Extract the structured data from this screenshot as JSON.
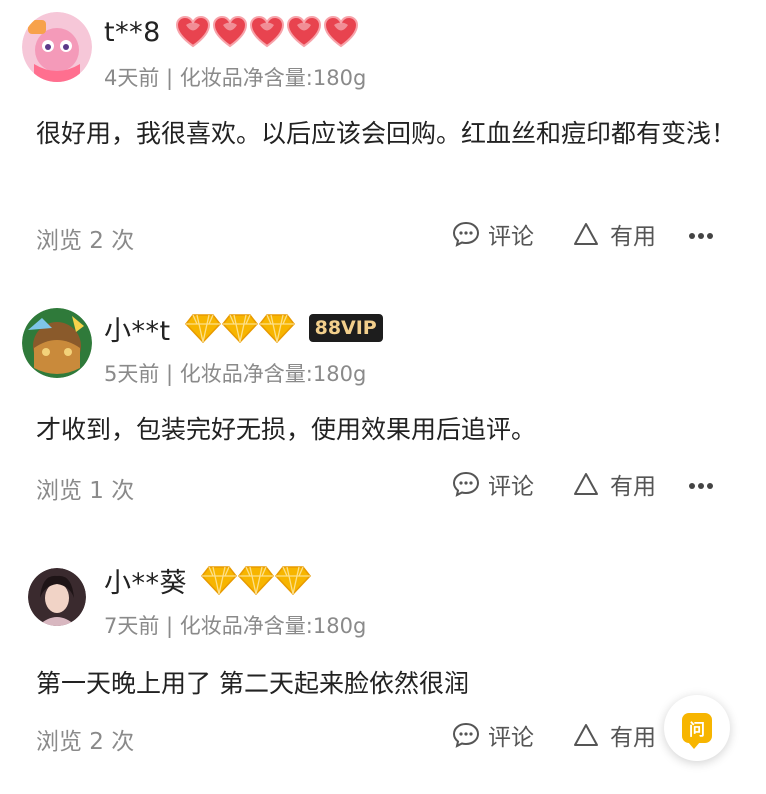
{
  "reviews": [
    {
      "username": "t**8",
      "level": "hearts",
      "level_count": 5,
      "vip": "",
      "meta": "4天前 | 化妆品净含量:180g",
      "content": "很好用，我很喜欢。以后应该会回购。红血丝和痘印都有变浅！",
      "views": "浏览 2 次",
      "comment_label": "评论",
      "useful_label": "有用"
    },
    {
      "username": "小**t",
      "level": "diamonds",
      "level_count": 3,
      "vip": "88VIP",
      "meta": "5天前 | 化妆品净含量:180g",
      "content": "才收到，包装完好无损，使用效果用后追评。",
      "views": "浏览 1 次",
      "comment_label": "评论",
      "useful_label": "有用"
    },
    {
      "username": "小**葵",
      "level": "diamonds",
      "level_count": 3,
      "vip": "",
      "meta": "7天前 | 化妆品净含量:180g",
      "content": "第一天晚上用了 第二天起来脸依然很润",
      "views": "浏览 2 次",
      "comment_label": "评论",
      "useful_label": "有用"
    }
  ],
  "fab": {
    "label": "问",
    "icon": "question-icon"
  },
  "colors": {
    "heart": "#e8434f",
    "diamond": "#f7b500",
    "vip_bg": "#1d1d1d",
    "vip_text": "#f2cf8c",
    "muted": "#8a8a8a"
  }
}
